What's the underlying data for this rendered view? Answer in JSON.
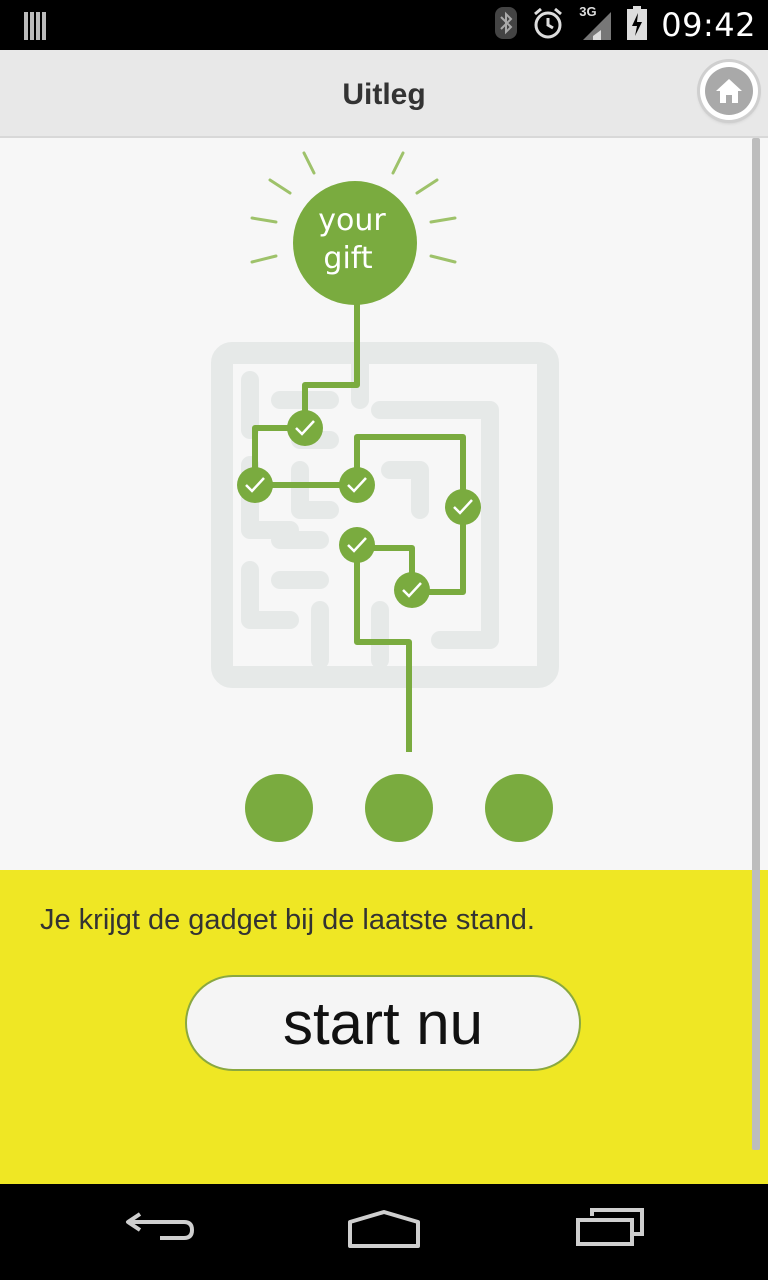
{
  "status_bar": {
    "network": "3G",
    "time": "09:42",
    "icons": [
      "notification-barcode-icon",
      "bluetooth-icon",
      "alarm-icon",
      "signal-icon",
      "battery-charging-icon"
    ]
  },
  "header": {
    "title": "Uitleg",
    "home_icon": "home-icon"
  },
  "illustration": {
    "gift_label_line1": "your",
    "gift_label_line2": "gift",
    "checkpoints": 6,
    "stands": 3,
    "accent_color": "#7aab3f",
    "maze_color": "#e6e9e8"
  },
  "panel": {
    "background_color": "#efe724",
    "description": "Je krijgt de gadget bij de laatste stand.",
    "start_label": "start nu"
  },
  "nav_bar": {
    "icons": [
      "back-icon",
      "home-nav-icon",
      "recent-apps-icon"
    ]
  }
}
